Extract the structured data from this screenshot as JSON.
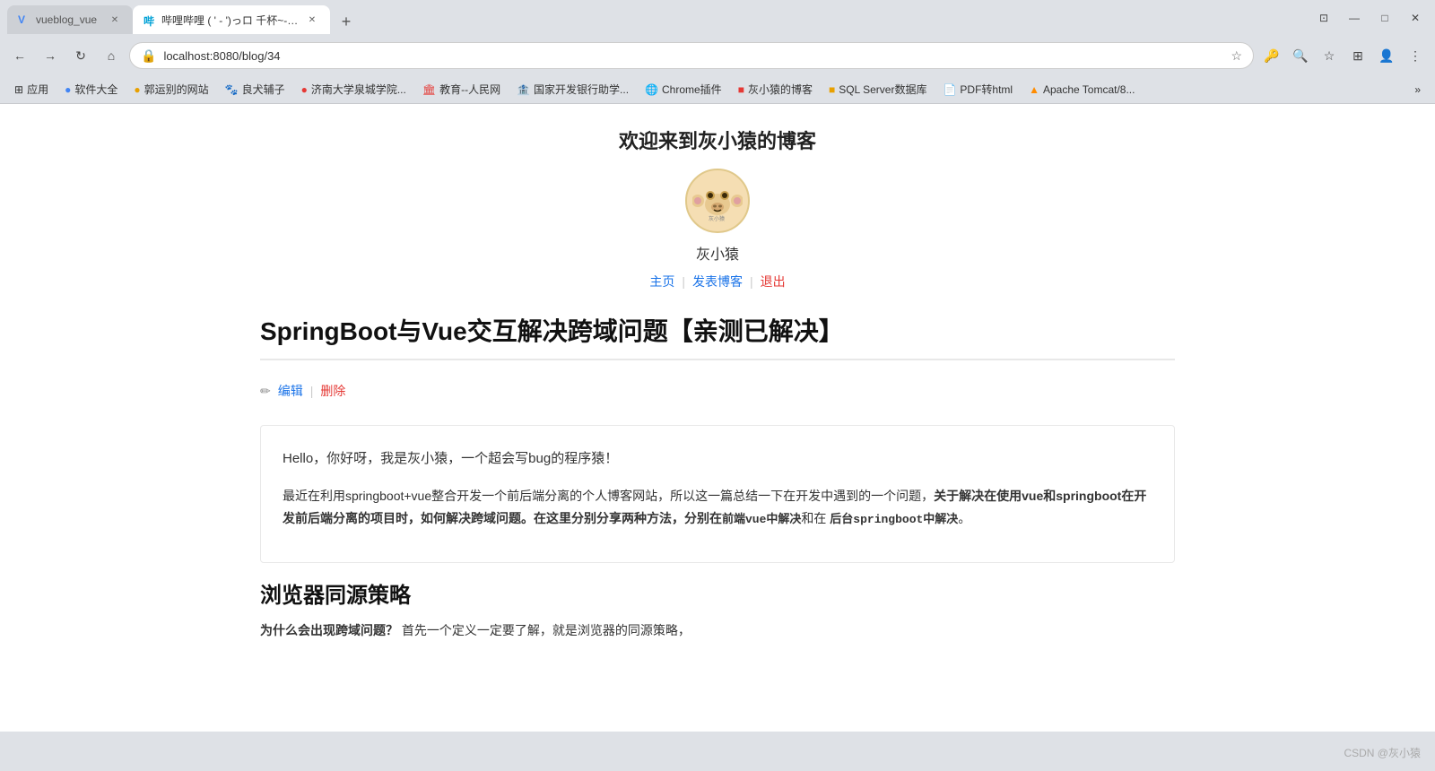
{
  "browser": {
    "tabs": [
      {
        "id": "tab1",
        "title": "vueblog_vue",
        "active": false,
        "favicon": "V"
      },
      {
        "id": "tab2",
        "title": "哔哩哔哩 ( ' - ')っロ 千杯~-bili...",
        "active": true,
        "favicon": "B"
      }
    ],
    "address": "localhost:8080/blog/34",
    "new_tab_label": "+",
    "nav": {
      "back_disabled": false,
      "forward_disabled": false
    }
  },
  "bookmarks": [
    {
      "label": "应用",
      "icon": "grid"
    },
    {
      "label": "软件大全",
      "icon": "circle"
    },
    {
      "label": "郭运别的网站",
      "icon": "globe"
    },
    {
      "label": "良犬辅子",
      "icon": "paw"
    },
    {
      "label": "济南大学泉城学院...",
      "icon": "school"
    },
    {
      "label": "教育--人民网",
      "icon": "edu"
    },
    {
      "label": "国家开发银行助学...",
      "icon": "bank"
    },
    {
      "label": "Chrome插件",
      "icon": "chrome"
    },
    {
      "label": "灰小猿的博客",
      "icon": "blog"
    },
    {
      "label": "SQL Server数据库",
      "icon": "db"
    },
    {
      "label": "PDF转html",
      "icon": "pdf"
    },
    {
      "label": "Apache Tomcat/8...",
      "icon": "server"
    }
  ],
  "page": {
    "site_title": "欢迎来到灰小猿的博客",
    "user_name": "灰小猿",
    "nav_links": [
      {
        "label": "主页",
        "type": "blue"
      },
      {
        "label": "发表博客",
        "type": "blue"
      },
      {
        "label": "退出",
        "type": "red"
      }
    ],
    "blog": {
      "title": "SpringBoot与Vue交互解决跨域问题【亲测已解决】",
      "edit_icon": "✏",
      "edit_label": "编辑",
      "delete_label": "删除",
      "intro": "Hello，你好呀，我是灰小猿，一个超会写bug的程序猿！",
      "paragraph1_start": "最近在利用springboot+vue整合开发一个前后端分离的个人博客网站，所以这一篇总结一下在开发中遇到的一个问题，",
      "paragraph1_bold": "关于解决在使用vue和springboot在开发前后端分离的项目时，如何解决跨域问题。在这里分别分享两种方法，分别在",
      "paragraph1_code1": "前端vue中解决",
      "paragraph1_mid": "和在",
      "paragraph1_code2": "后台springboot中解决",
      "paragraph1_end": "。",
      "section1_title": "浏览器同源策略",
      "section1_text_bold": "为什么会出现跨域问题？",
      "section1_text": "首先一个定义一定要了解，就是浏览器的同源策略，"
    }
  },
  "watermark": "CSDN @灰小猿",
  "icons": {
    "back": "←",
    "forward": "→",
    "reload": "↻",
    "home": "⌂",
    "lock": "🔒",
    "star": "☆",
    "extensions": "⊞",
    "profile": "👤",
    "menu": "⋮",
    "minimize": "—",
    "maximize": "□",
    "close": "✕"
  }
}
